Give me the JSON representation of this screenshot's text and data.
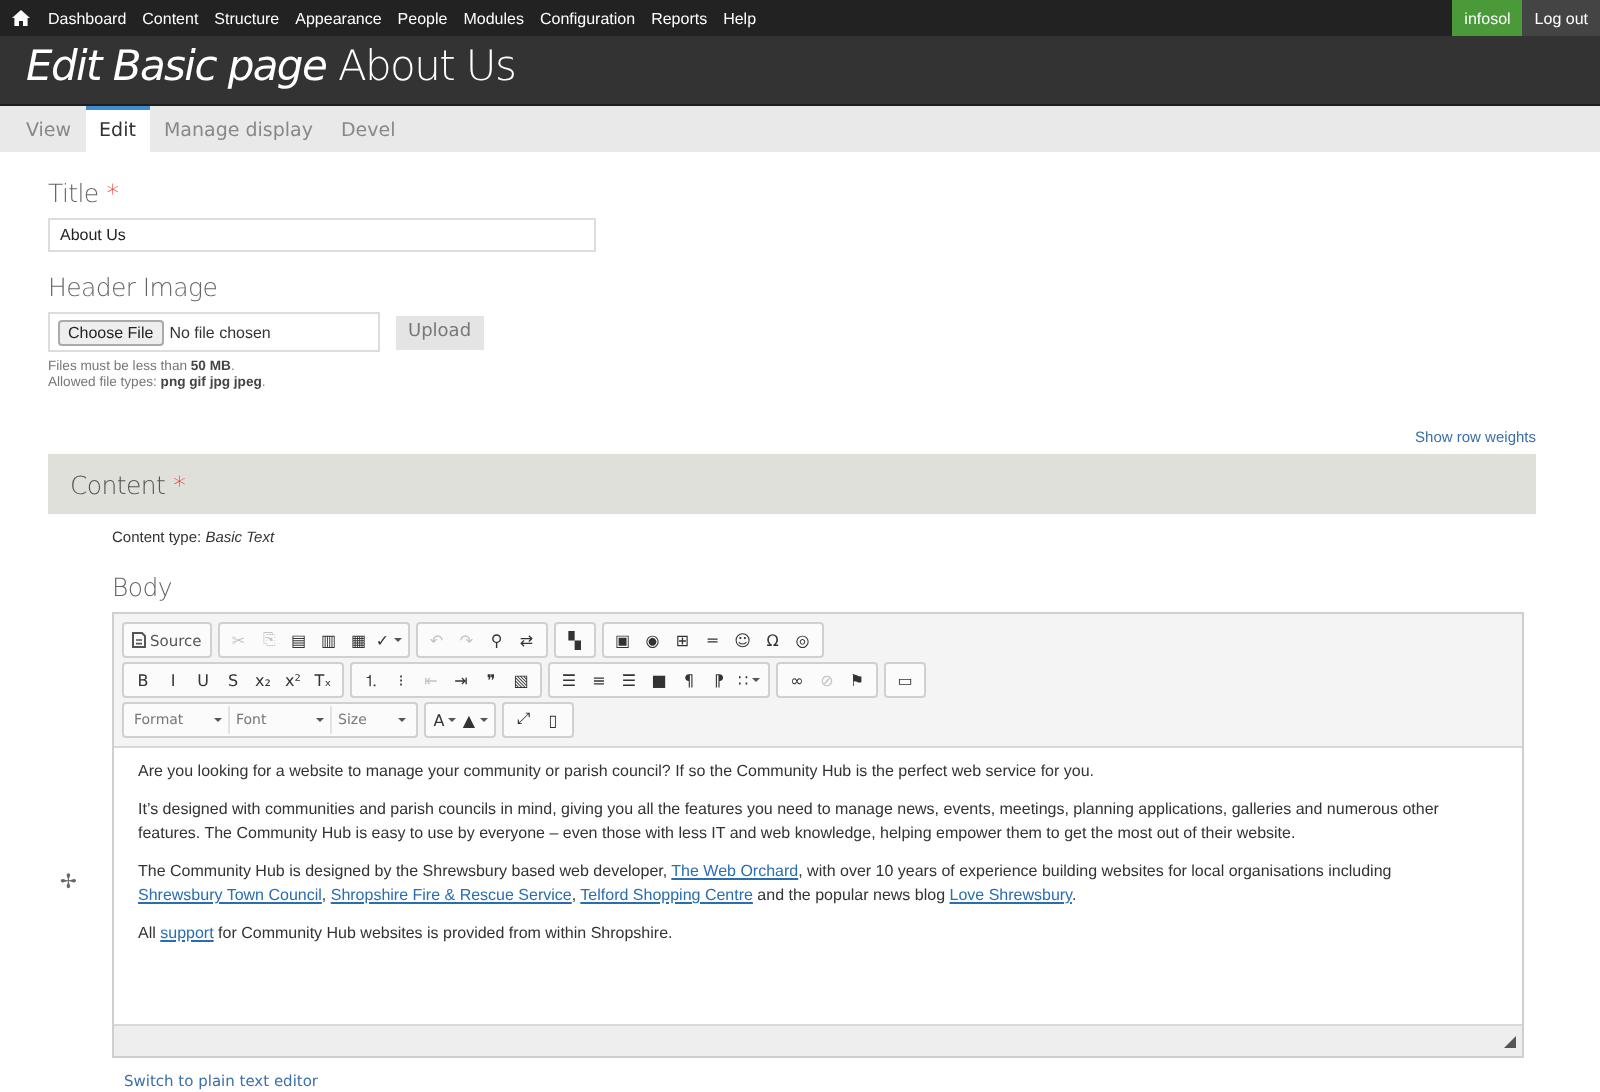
{
  "admin_menu": {
    "items": [
      "Dashboard",
      "Content",
      "Structure",
      "Appearance",
      "People",
      "Modules",
      "Configuration",
      "Reports",
      "Help"
    ],
    "user": "infosol",
    "logout": "Log out"
  },
  "page_title": "*Edit Basic page* About Us",
  "tabs": [
    {
      "label": "View",
      "selected": false
    },
    {
      "label": "Edit",
      "selected": true
    },
    {
      "label": "Manage display",
      "selected": false
    },
    {
      "label": "Devel",
      "selected": false
    }
  ],
  "title_field": {
    "label": "Title",
    "required_mark": "*",
    "value": "About Us"
  },
  "header_image": {
    "label": "Header Image",
    "choose_button": "Choose File",
    "file_status": "No file chosen",
    "upload_button": "Upload",
    "help": [
      "Files must be less than **50 MB**.",
      "Allowed file types: **png gif jpg jpeg**."
    ]
  },
  "show_row_weights": "Show row weights",
  "content_section": {
    "label": "Content",
    "required_mark": "*",
    "content_type": "Content type: *Basic Text*",
    "drag_handle": "✢",
    "body_label": "Body",
    "toolbar_rows": [
      [
        [
          {
            "kind": "source",
            "label": "Source",
            "disabled": false
          }
        ],
        [
          {
            "kind": "button",
            "glyph": "✂",
            "disabled": true
          },
          {
            "kind": "button",
            "glyph": "⎘",
            "disabled": true
          },
          {
            "kind": "button",
            "glyph": "▤",
            "disabled": false
          },
          {
            "kind": "button",
            "glyph": "▥",
            "disabled": false
          },
          {
            "kind": "button",
            "glyph": "▦",
            "disabled": false
          },
          {
            "kind": "menu",
            "glyph": "✓",
            "disabled": false
          }
        ],
        [
          {
            "kind": "button",
            "glyph": "↶",
            "disabled": true
          },
          {
            "kind": "button",
            "glyph": "↷",
            "disabled": true
          },
          {
            "kind": "button",
            "glyph": "⚲",
            "disabled": false
          },
          {
            "kind": "button",
            "glyph": "⇄",
            "disabled": false
          }
        ],
        [
          {
            "kind": "button",
            "glyph": "▚",
            "disabled": false
          }
        ],
        [
          {
            "kind": "button",
            "glyph": "▣",
            "disabled": false
          },
          {
            "kind": "button",
            "glyph": "◉",
            "disabled": false
          },
          {
            "kind": "button",
            "glyph": "⊞",
            "disabled": false
          },
          {
            "kind": "button",
            "glyph": "═",
            "disabled": false
          },
          {
            "kind": "button",
            "glyph": "☺",
            "disabled": false
          },
          {
            "kind": "button",
            "glyph": "Ω",
            "disabled": false
          },
          {
            "kind": "button",
            "glyph": "◎",
            "disabled": false
          }
        ]
      ],
      [
        [
          {
            "kind": "button",
            "glyph": "B",
            "disabled": false
          },
          {
            "kind": "button",
            "glyph": "I",
            "disabled": false
          },
          {
            "kind": "button",
            "glyph": "U",
            "disabled": false
          },
          {
            "kind": "button",
            "glyph": "S",
            "disabled": false
          },
          {
            "kind": "button",
            "glyph": "x₂",
            "disabled": false
          },
          {
            "kind": "button",
            "glyph": "x²",
            "disabled": false
          },
          {
            "kind": "button",
            "glyph": "Tₓ",
            "disabled": false
          }
        ],
        [
          {
            "kind": "button",
            "glyph": "⒈",
            "disabled": false
          },
          {
            "kind": "button",
            "glyph": "⁝",
            "disabled": false
          },
          {
            "kind": "button",
            "glyph": "⇤",
            "disabled": true
          },
          {
            "kind": "button",
            "glyph": "⇥",
            "disabled": false
          },
          {
            "kind": "button",
            "glyph": "❞",
            "disabled": false
          },
          {
            "kind": "button",
            "glyph": "▧",
            "disabled": false
          }
        ],
        [
          {
            "kind": "button",
            "glyph": "☰",
            "disabled": false
          },
          {
            "kind": "button",
            "glyph": "≡",
            "disabled": false
          },
          {
            "kind": "button",
            "glyph": "☰",
            "disabled": false
          },
          {
            "kind": "button",
            "glyph": "■",
            "disabled": false
          },
          {
            "kind": "button",
            "glyph": "¶",
            "disabled": false
          },
          {
            "kind": "button",
            "glyph": "⁋",
            "disabled": false
          },
          {
            "kind": "menu",
            "glyph": "∷",
            "disabled": false
          }
        ],
        [
          {
            "kind": "button",
            "glyph": "∞",
            "disabled": false
          },
          {
            "kind": "button",
            "glyph": "⊘",
            "disabled": true
          },
          {
            "kind": "button",
            "glyph": "⚑",
            "disabled": false
          }
        ],
        [
          {
            "kind": "button",
            "glyph": "▭",
            "disabled": false
          }
        ]
      ],
      [
        [
          {
            "kind": "combo",
            "label": "Format",
            "disabled": false
          },
          {
            "kind": "combo",
            "label": "Font",
            "disabled": false
          },
          {
            "kind": "combo",
            "label": "Size",
            "disabled": false
          }
        ],
        [
          {
            "kind": "menu",
            "glyph": "A",
            "disabled": false
          },
          {
            "kind": "menu",
            "glyph": "▲",
            "disabled": false
          }
        ],
        [
          {
            "kind": "button",
            "glyph": "⤢",
            "disabled": false
          },
          {
            "kind": "button",
            "glyph": "▯",
            "disabled": false
          }
        ]
      ]
    ],
    "paragraphs": [
      [
        {
          "text": "Are you looking for a website to manage your community or parish council? If so the Community Hub is the perfect web service for you.",
          "link": false
        }
      ],
      [
        {
          "text": "It’s designed with communities and parish councils in mind, giving you all the features you need to manage news, events, meetings, planning applications, galleries and numerous other features. The Community Hub is easy to use by everyone – even those with less IT and web knowledge, helping empower them to get the most out of their website.",
          "link": false
        }
      ],
      [
        {
          "text": "The Community Hub is designed by the Shrewsbury based web developer, ",
          "link": false
        },
        {
          "text": "The Web Orchard",
          "link": true
        },
        {
          "text": ", with over 10 years of experience building websites for local organisations including ",
          "link": false
        },
        {
          "text": "Shrewsbury Town Council",
          "link": true
        },
        {
          "text": ", ",
          "link": false
        },
        {
          "text": "Shropshire Fire & Rescue Service",
          "link": true
        },
        {
          "text": ", ",
          "link": false
        },
        {
          "text": "Telford Shopping Centre",
          "link": true
        },
        {
          "text": " and the popular news blog ",
          "link": false
        },
        {
          "text": "Love Shrewsbury",
          "link": true
        },
        {
          "text": ".",
          "link": false
        }
      ],
      [
        {
          "text": "All ",
          "link": false
        },
        {
          "text": "support",
          "link": true
        },
        {
          "text": " for Community Hub websites is provided from within Shropshire.",
          "link": false
        }
      ]
    ],
    "switch_link": "Switch to plain text editor"
  }
}
